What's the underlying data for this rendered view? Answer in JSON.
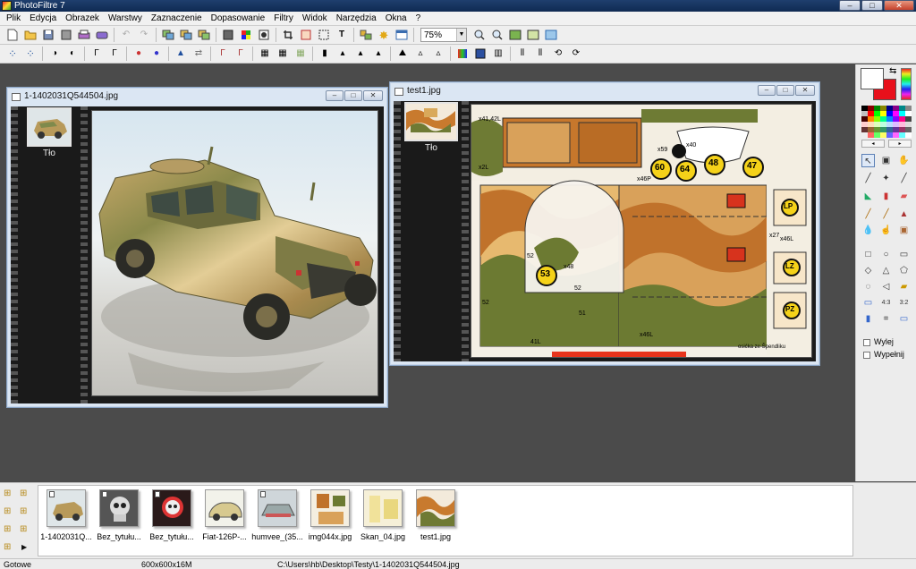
{
  "app": {
    "title": "PhotoFiltre 7"
  },
  "window_buttons": {
    "minimize": "–",
    "maximize": "□",
    "close": "✕"
  },
  "menu": [
    "Plik",
    "Edycja",
    "Obrazek",
    "Warstwy",
    "Zaznaczenie",
    "Dopasowanie",
    "Filtry",
    "Widok",
    "Narzędzia",
    "Okna",
    "?"
  ],
  "toolbar": {
    "zoom_value": "75%"
  },
  "documents": [
    {
      "title": "1-1402031Q544504.jpg",
      "layers": [
        {
          "label": "Tło"
        }
      ]
    },
    {
      "title": "test1.jpg",
      "layers": [
        {
          "label": "Tło"
        }
      ]
    }
  ],
  "camo_labels": {
    "n60": "60",
    "n64": "64",
    "n48": "48",
    "n47": "47",
    "n53": "53",
    "lp": "LP",
    "lz": "LZ",
    "pz": "PZ",
    "x40": "x40",
    "x59": "x59",
    "x46p": "x46P",
    "x41": "x41,42L",
    "x2l": "x2L",
    "x48": "x48",
    "x46l": "x46L",
    "x27": "x27",
    "x46l2": "x46L",
    "n41l": "41L",
    "n52a": "52",
    "n52b": "52",
    "n52c": "52",
    "n51": "51",
    "credit": "osićka ze Špendliku"
  },
  "tools_panel": {
    "options": [
      {
        "label": "Wylej"
      },
      {
        "label": "Wypełnij"
      }
    ]
  },
  "thumbnails": [
    {
      "label": "1-1402031Q..."
    },
    {
      "label": "Bez_tytułu..."
    },
    {
      "label": "Bez_tytułu..."
    },
    {
      "label": "Fiat-126P-..."
    },
    {
      "label": "humvee_(35..."
    },
    {
      "label": "img044x.jpg"
    },
    {
      "label": "Skan_04.jpg"
    },
    {
      "label": "test1.jpg"
    }
  ],
  "status": {
    "state": "Gotowe",
    "dimensions": "600x600x16M",
    "path": "C:\\Users\\hb\\Desktop\\Testy\\1-1402031Q544504.jpg"
  },
  "colors": {
    "foreground": "#ffffff",
    "background": "#e8101b",
    "accent": "#2c5aa0"
  }
}
